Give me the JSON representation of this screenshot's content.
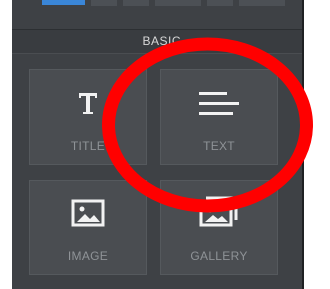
{
  "panel": {
    "section_title": "BASIC",
    "tiles": [
      {
        "label": "TITLE",
        "icon": "title-t-icon"
      },
      {
        "label": "TEXT",
        "icon": "text-lines-icon"
      },
      {
        "label": "IMAGE",
        "icon": "image-icon"
      },
      {
        "label": "GALLERY",
        "icon": "gallery-icon"
      }
    ]
  },
  "colors": {
    "panel_bg": "#3e4145",
    "tile_bg": "#4a4d51",
    "tile_label": "#8f9397",
    "icon": "#f2f2f2",
    "active_tab": "#3a86d8",
    "annotation_ring": "#ff0000"
  }
}
